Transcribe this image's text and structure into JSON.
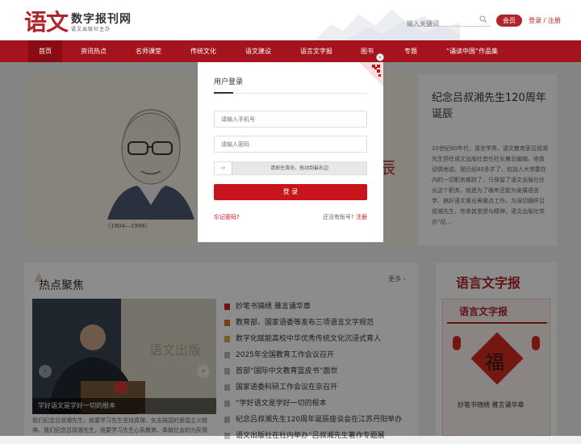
{
  "header": {
    "logo_cn": "语文",
    "logo_title": "数字报刊网",
    "logo_subtitle": "语文出版社主办",
    "search_placeholder": "输入关键词",
    "member_button": "会员",
    "login_label": "登录",
    "divider": "/",
    "register_label": "注册"
  },
  "nav": {
    "items": [
      {
        "label": "首页",
        "active": true
      },
      {
        "label": "资讯热点"
      },
      {
        "label": "名师课堂"
      },
      {
        "label": "传统文化"
      },
      {
        "label": "语文建设"
      },
      {
        "label": "语言文字报"
      },
      {
        "label": "图书"
      },
      {
        "label": "专题"
      },
      {
        "label": "“诵读中国”作品集"
      }
    ]
  },
  "banner": {
    "dates": "（1904—1998）",
    "partial_text": "辰"
  },
  "side_card": {
    "title": "纪念吕叔湘先生120周年诞辰",
    "body": "20世纪80年代，语言学界、语文教育家吕叔湘先生担任语文出版社首任社长兼总编辑。他曾动情地说，我已经80多岁了，包括人大常委在内的一切职务都辞了，只保留了语文出版社社长这个职务，就是为了晚年还能为发展语言学、搞好语文事业再做点工作。为深切缅怀吕叔湘先生，传承其思想与精神，语文出版社举办“纪..."
  },
  "hot": {
    "title": "热点聚焦",
    "more": "更多",
    "more_icon": "chevron-right-icon",
    "image_caption": "学好语文是学好一切的根本",
    "image_backdrop": "语文出版",
    "desc": "我们纪念吕叔湘先生，就要学习先生坚持真理、矢志报国的爱国主义精神。我们纪念吕叔湘先生，就要学习先生心系教育、奉献社会的为民情怀……",
    "prev": "‹",
    "next": "›",
    "news": [
      "妙笔书锦绣 雅言诵华章",
      "教育部、国家语委等发布三项语言文字规范",
      "数字化赋能高校中华优秀传统文化沉浸式育人",
      "2025年全国教育工作会议召开",
      "首部“国际中文教育蓝皮书”面世",
      "国家语委科研工作会议在京召开",
      "“学好语文是学好一切的根本",
      "纪念吕叔湘先生120周年诞辰座谈会在江苏丹阳举办",
      "语文出版社在社内举办“吕叔湘先生著作专题展"
    ]
  },
  "paper": {
    "title": "语言文字报",
    "masthead": "语言文字报",
    "fu": "福",
    "headline": "妙笔书锦绣 雅言诵华章"
  },
  "modal": {
    "title": "用户登录",
    "close": "×",
    "phone_placeholder": "请输入手机号",
    "password_placeholder": "请输入密码",
    "slider_handle": "››",
    "slider_text": "请按住滑块，拖动到最右边",
    "login_button": "登 录",
    "forgot": "忘记密码?",
    "no_account": "还没有账号?",
    "register": "注册"
  },
  "colors": {
    "brand_red": "#a5131c",
    "accent_red": "#c8151d"
  }
}
